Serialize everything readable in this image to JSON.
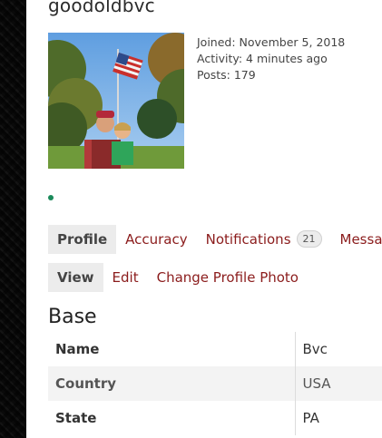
{
  "profile": {
    "username": "goodoldbvc",
    "joined": "Joined: November 5, 2018",
    "activity": "Activity: 4 minutes ago",
    "posts": "Posts: 179"
  },
  "tabs": [
    {
      "label": "Profile",
      "active": true
    },
    {
      "label": "Accuracy"
    },
    {
      "label": "Notifications",
      "badge": "21"
    },
    {
      "label": "Messag"
    }
  ],
  "subtabs": [
    {
      "label": "View",
      "active": true
    },
    {
      "label": "Edit"
    },
    {
      "label": "Change Profile Photo"
    }
  ],
  "section": {
    "title": "Base",
    "rows": [
      {
        "label": "Name",
        "value": "Bvc"
      },
      {
        "label": "Country",
        "value": "USA"
      },
      {
        "label": "State",
        "value": "PA"
      }
    ]
  },
  "colors": {
    "link": "#8b1c1c",
    "online": "#1a8a5a",
    "tab_bg": "#ececec"
  },
  "icons": {
    "online": "online-status-dot"
  }
}
